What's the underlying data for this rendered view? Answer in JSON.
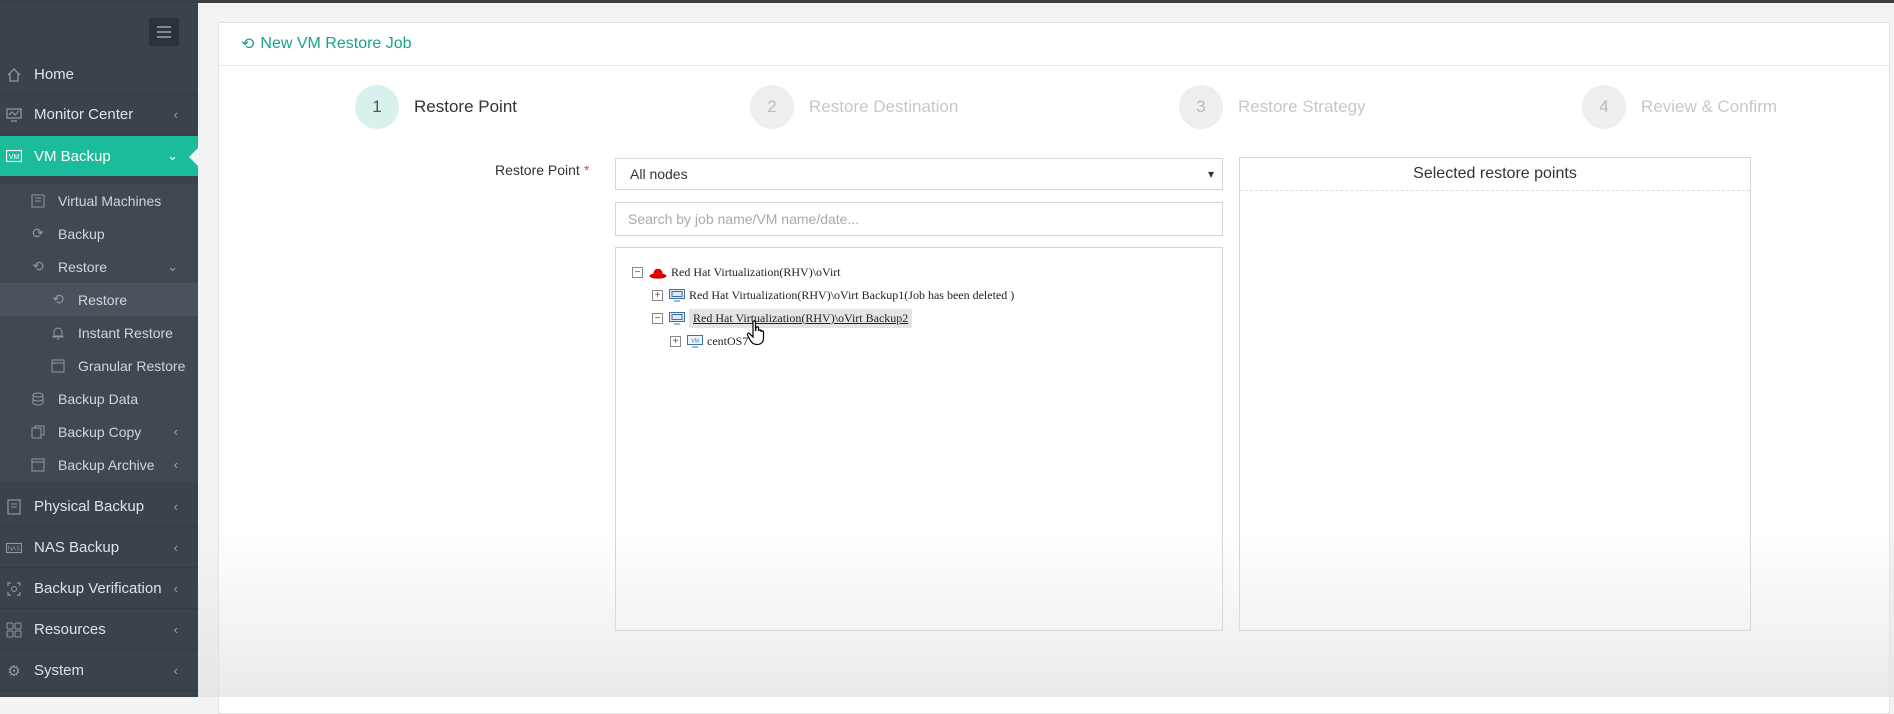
{
  "colors": {
    "accent": "#1abc9c",
    "sidebar_bg": "#3a424a",
    "required": "#e04b4b"
  },
  "sidebar": {
    "toggle_icon": "menu-icon",
    "items": [
      {
        "label": "Home",
        "icon": "home-icon"
      },
      {
        "label": "Monitor Center",
        "icon": "monitor-icon"
      },
      {
        "label": "VM Backup",
        "icon": "vm-icon"
      },
      {
        "label": "Virtual Machines",
        "icon": "vm-list-icon"
      },
      {
        "label": "Backup",
        "icon": "refresh-icon"
      },
      {
        "label": "Restore",
        "icon": "restore-icon"
      },
      {
        "label": "Restore",
        "icon": "restore-icon"
      },
      {
        "label": "Instant Restore",
        "icon": "bell-icon"
      },
      {
        "label": "Granular Restore",
        "icon": "window-icon"
      },
      {
        "label": "Backup Data",
        "icon": "database-icon"
      },
      {
        "label": "Backup Copy",
        "icon": "copy-icon"
      },
      {
        "label": "Backup Archive",
        "icon": "archive-icon"
      },
      {
        "label": "Physical Backup",
        "icon": "server-icon"
      },
      {
        "label": "NAS Backup",
        "icon": "nas-icon"
      },
      {
        "label": "Backup Verification",
        "icon": "verify-icon"
      },
      {
        "label": "Resources",
        "icon": "grid-icon"
      },
      {
        "label": "System",
        "icon": "gear-icon"
      }
    ]
  },
  "page": {
    "title": "New VM Restore Job"
  },
  "steps": [
    {
      "num": "1",
      "label": "Restore Point"
    },
    {
      "num": "2",
      "label": "Restore Destination"
    },
    {
      "num": "3",
      "label": "Restore Strategy"
    },
    {
      "num": "4",
      "label": "Review & Confirm"
    }
  ],
  "form": {
    "restore_point_label": "Restore Point",
    "required_mark": "*",
    "select_value": "All nodes",
    "search_placeholder": "Search by job name/VM name/date..."
  },
  "tree": {
    "root": "Red Hat Virtualization(RHV)\\oVirt",
    "job1": "Red Hat Virtualization(RHV)\\oVirt Backup1(Job has been deleted )",
    "job2": "Red Hat Virtualization(RHV)\\oVirt Backup2",
    "vm": "centOS7"
  },
  "right_panel": {
    "title": "Selected restore points"
  }
}
